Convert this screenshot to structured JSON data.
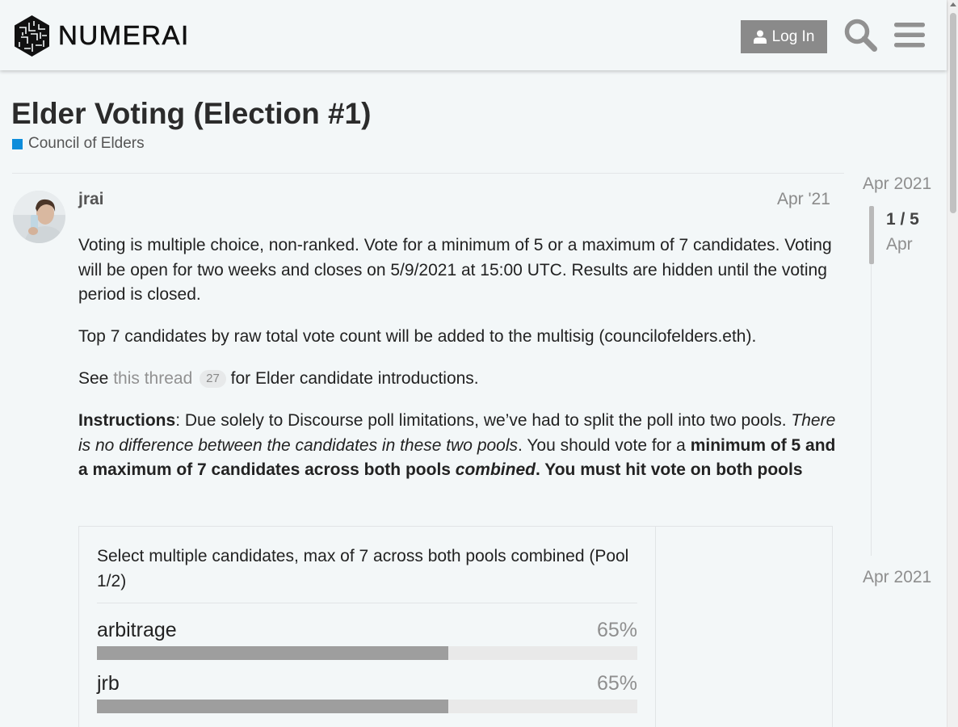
{
  "header": {
    "logo_text": "NUMERAI",
    "login_label": "Log In",
    "icons": [
      "logo-icon",
      "user-icon",
      "search-icon",
      "hamburger-menu-icon"
    ]
  },
  "topic": {
    "title": "Elder Voting (Election #1)",
    "category": "Council of Elders",
    "category_color": "#0e8ddb"
  },
  "post": {
    "username": "jrai",
    "date": "Apr '21",
    "paragraph1": "Voting is multiple choice, non-ranked. Vote for a minimum of 5 or a maximum of 7 candidates. Voting will be open for two weeks and closes on 5/9/2021 at 15:00 UTC. Results are hidden until the voting period is closed.",
    "paragraph2": "Top 7 candidates by raw total vote count will be added to the multisig (councilofelders.eth).",
    "p3_prefix": "See ",
    "p3_link": "this thread",
    "p3_badge": "27",
    "p3_suffix": " for Elder candidate introductions.",
    "instructions_label": "Instructions",
    "instructions_text": ": Due solely to Discourse poll limitations, we’ve had to split the poll into two pools. ",
    "instructions_italic": "There is no difference between the candidates in these two pools",
    "instructions_text2": ". You should vote for a ",
    "instructions_bold": "minimum of 5 and a maximum of 7 candidates across both pools ",
    "instructions_bold_italic": "combined",
    "instructions_bold2": ". You must hit vote on both pools"
  },
  "poll": {
    "title": "Select multiple candidates, max of 7 across both pools combined (Pool 1/2)",
    "options": [
      {
        "label": "arbitrage",
        "percent_label": "65%",
        "percent": 65
      },
      {
        "label": "jrb",
        "percent_label": "65%",
        "percent": 65
      }
    ]
  },
  "timeline": {
    "start_date": "Apr 2021",
    "position": "1 / 5",
    "position_date": "Apr",
    "end_date": "Apr 2021"
  }
}
